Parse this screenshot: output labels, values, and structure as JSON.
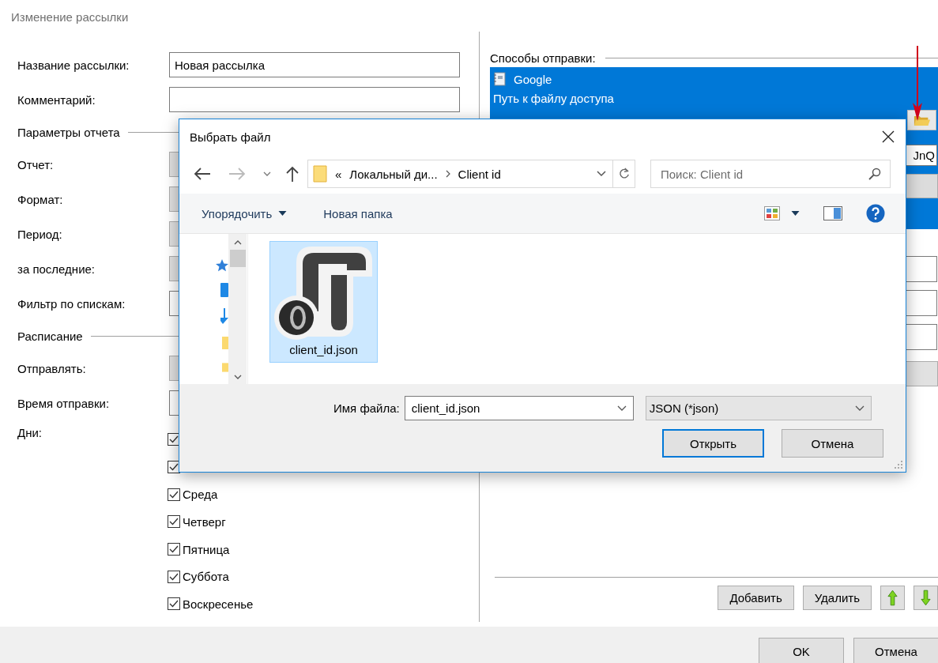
{
  "window": {
    "title": "Изменение рассылки"
  },
  "form": {
    "rows": [
      {
        "kind": "input",
        "label": "Название рассылки:",
        "value": "Новая рассылка"
      },
      {
        "kind": "input",
        "label": "Комментарий:"
      },
      {
        "kind": "section",
        "label": "Параметры отчета"
      },
      {
        "kind": "combo",
        "label": "Отчет:"
      },
      {
        "kind": "combo",
        "label": "Формат:"
      },
      {
        "kind": "combo",
        "label": "Период:"
      },
      {
        "kind": "combo",
        "label": "за последние:"
      },
      {
        "kind": "input",
        "label": "Фильтр по спискам:"
      },
      {
        "kind": "section",
        "label": "Расписание"
      },
      {
        "kind": "combo",
        "label": "Отправлять:"
      },
      {
        "kind": "input",
        "label": "Время отправки:"
      },
      {
        "kind": "days",
        "label": "Дни:",
        "days": [
          {
            "checked": true
          },
          {
            "checked": true
          },
          {
            "label": "Среда",
            "checked": true
          },
          {
            "label": "Четверг",
            "checked": true
          },
          {
            "label": "Пятница",
            "checked": true
          },
          {
            "label": "Суббота",
            "checked": true
          },
          {
            "label": "Воскресенье",
            "checked": true
          }
        ]
      }
    ]
  },
  "methods": {
    "title": "Способы отправки:",
    "items": [
      {
        "name": "Google",
        "selected": true,
        "detail_label": "Путь к файлу доступа",
        "key_value": "JnQ"
      }
    ],
    "buttons": [
      {
        "kind": "text",
        "label": "Добавить"
      },
      {
        "kind": "text",
        "label": "Удалить"
      },
      {
        "kind": "up"
      },
      {
        "kind": "down"
      }
    ]
  },
  "footer": {
    "buttons": [
      "OK",
      "Отмена"
    ]
  },
  "dialog": {
    "title": "Выбрать файл",
    "address": {
      "overflow": "«",
      "path": [
        "Локальный ди...",
        "Client id"
      ]
    },
    "search": {
      "placeholder": "Поиск: Client id"
    },
    "toolbar": [
      {
        "label": "Упорядочить",
        "dropdown": true
      },
      {
        "label": "Новая папка",
        "dropdown": false
      }
    ],
    "files": [
      {
        "name": "client_id.json",
        "selected": true
      }
    ],
    "filename": {
      "label": "Имя файла:",
      "value": "client_id.json"
    },
    "filter": "JSON (*json)",
    "buttons": [
      {
        "label": "Открыть",
        "default": true
      },
      {
        "label": "Отмена",
        "default": false
      }
    ]
  }
}
